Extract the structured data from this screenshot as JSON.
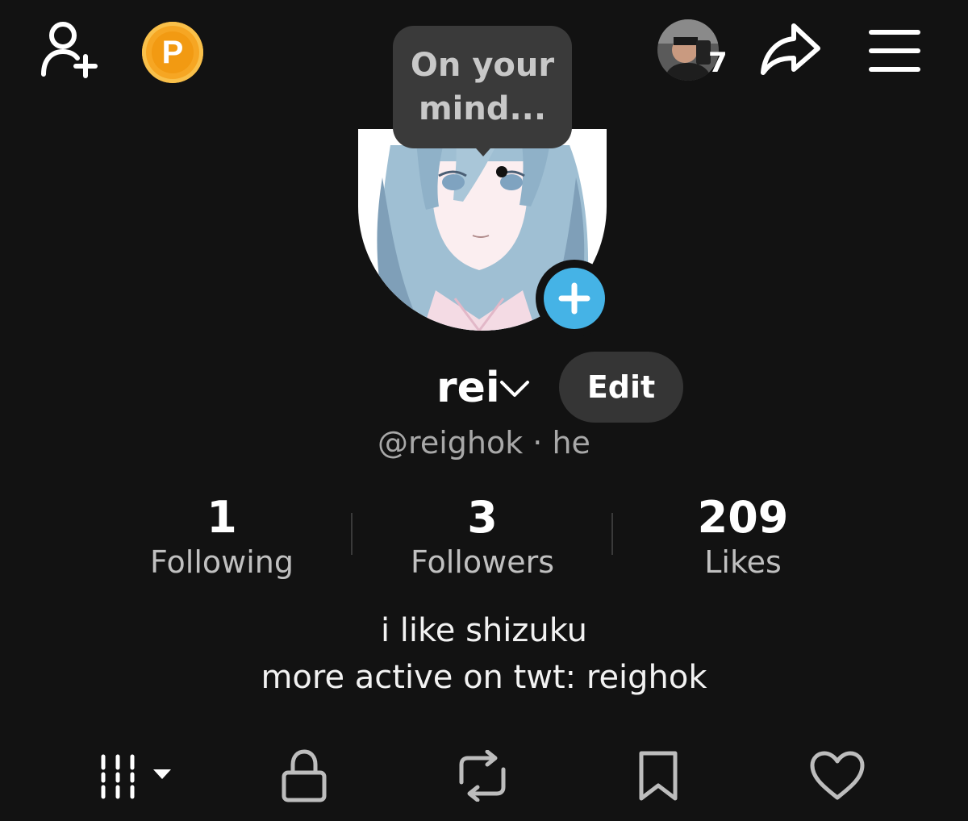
{
  "header": {
    "story_count": "7"
  },
  "tooltip": {
    "text_line1": "On your",
    "text_line2": "mind..."
  },
  "profile": {
    "name": "rei",
    "edit_label": "Edit",
    "handle_line": "@reighok · he",
    "bio_line1": "i like shizuku",
    "bio_line2": "more active on twt: reighok"
  },
  "stats": [
    {
      "value": "1",
      "label": "Following"
    },
    {
      "value": "3",
      "label": "Followers"
    },
    {
      "value": "209",
      "label": "Likes"
    }
  ],
  "icons": {
    "add_user": "add-user-icon",
    "coin": "coin-icon",
    "share": "share-icon",
    "menu": "menu-icon",
    "tabs": [
      "grid-icon",
      "lock-icon",
      "repost-icon",
      "bookmark-icon",
      "heart-icon"
    ]
  },
  "colors": {
    "background": "#121212",
    "accent_blue": "#45b3e6",
    "coin_orange": "#f6a623",
    "tooltip_bg": "#3a3a3a",
    "button_bg": "#353535"
  }
}
